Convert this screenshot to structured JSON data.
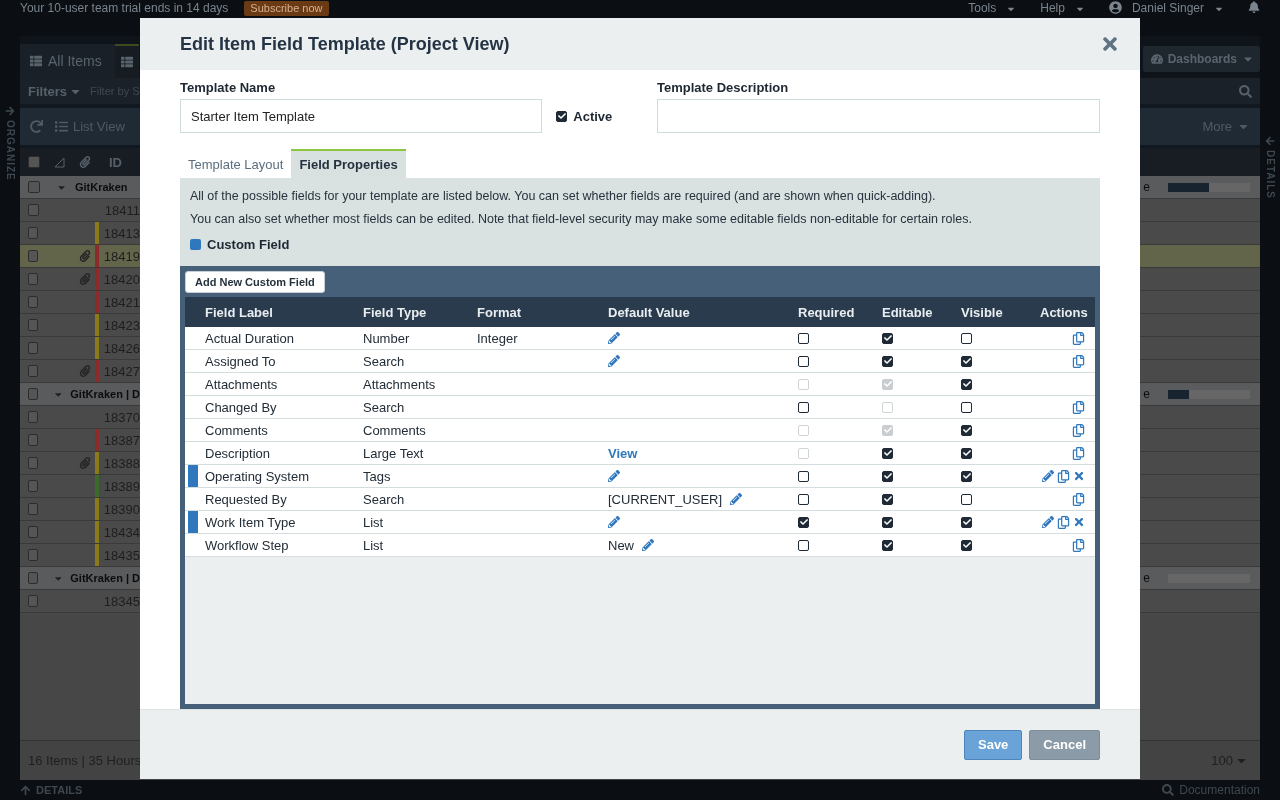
{
  "app": {
    "banner": {
      "text": "Your 10-user team trial ends in 14 days",
      "button": "Subscribe now"
    },
    "top_menu": [
      "Tools",
      "Help"
    ],
    "user": "Daniel Singer",
    "header_checked": false,
    "view_tab": "All Items",
    "dashboards": "Dashboards",
    "filters": "Filters",
    "filter_placeholder": "Filter by S",
    "list_view": "List View",
    "more": "More",
    "id_header": "ID",
    "organize": "ORGANIZE",
    "details_side": "DETAILS",
    "groups": [
      {
        "name": "GitKraken",
        "suffix": "e",
        "level": 0.5,
        "checked": false,
        "items": [
          {
            "id": "18411",
            "attachment": false,
            "selected": false,
            "checked": false
          },
          {
            "id": "18413",
            "attachment": false,
            "selected": false,
            "checked": false,
            "color": "#8a7a1c"
          },
          {
            "id": "18419",
            "attachment": true,
            "selected": true,
            "checked": false,
            "color": "#8a2c2c"
          },
          {
            "id": "18420",
            "attachment": true,
            "selected": false,
            "checked": false,
            "color": "#8a2c2c"
          },
          {
            "id": "18421",
            "attachment": false,
            "selected": false,
            "checked": false,
            "color": "#8a2c2c"
          },
          {
            "id": "18423",
            "attachment": false,
            "selected": false,
            "checked": false,
            "color": "#8a7a1c"
          },
          {
            "id": "18426",
            "attachment": false,
            "selected": false,
            "checked": false,
            "color": "#8a7a1c"
          },
          {
            "id": "18427",
            "attachment": true,
            "selected": false,
            "checked": false,
            "color": "#8a2c2c"
          }
        ]
      },
      {
        "name": "GitKraken | D",
        "suffix": "e",
        "level": 0.25,
        "checked": false,
        "items": [
          {
            "id": "18370",
            "attachment": false,
            "selected": false,
            "checked": false
          },
          {
            "id": "18387",
            "attachment": false,
            "selected": false,
            "checked": false,
            "color": "#8a2c2c"
          },
          {
            "id": "18388",
            "attachment": true,
            "selected": false,
            "checked": false,
            "color": "#8a7a1c"
          },
          {
            "id": "18389",
            "attachment": false,
            "selected": false,
            "checked": false,
            "color": "#3c6a2a"
          },
          {
            "id": "18390",
            "attachment": false,
            "selected": false,
            "checked": false,
            "color": "#8a7a1c"
          },
          {
            "id": "18434",
            "attachment": false,
            "selected": false,
            "checked": false,
            "color": "#8a7a1c"
          },
          {
            "id": "18435",
            "attachment": false,
            "selected": false,
            "checked": false,
            "color": "#8a7a1c"
          }
        ]
      },
      {
        "name": "GitKraken | D",
        "suffix": "e",
        "level": 0,
        "checked": false,
        "items": [
          {
            "id": "18345",
            "attachment": false,
            "selected": false,
            "checked": false
          }
        ]
      }
    ],
    "footer": {
      "summary": "16 Items | 35 Hours",
      "page_size": "100"
    },
    "bottom_bar": {
      "details": "DETAILS",
      "documentation": "Documentation"
    }
  },
  "dialog": {
    "title": "Edit Item Field Template (Project View)",
    "template_name": {
      "label": "Template Name",
      "value": "Starter Item Template"
    },
    "active": {
      "label": "Active",
      "checked": true
    },
    "template_description": {
      "label": "Template Description"
    },
    "tabs": [
      {
        "label": "Template Layout",
        "selected": false
      },
      {
        "label": "Field Properties",
        "selected": true
      }
    ],
    "info": [
      "All of the possible fields for your template are listed below. You can set whether fields are required (and are shown when quick-adding).",
      "You can also set whether most fields can be edited. Note that field-level security may make some editable fields non-editable for certain roles."
    ],
    "legend": {
      "label": "Custom Field",
      "color": "#2f78bd"
    },
    "add_button": "Add New Custom Field",
    "columns": [
      "Field Label",
      "Field Type",
      "Format",
      "Default Value",
      "Required",
      "Editable",
      "Visible",
      "Actions"
    ],
    "rows": [
      {
        "label": "Actual Duration",
        "type": "Number",
        "format": "Integer",
        "custom": false,
        "default": {
          "kind": "edit"
        },
        "required": {
          "checked": false,
          "disabled": false
        },
        "editable": {
          "checked": true,
          "disabled": false
        },
        "visible": {
          "checked": false,
          "disabled": false
        },
        "actions": [
          {
            "kind": "copy"
          }
        ]
      },
      {
        "label": "Assigned To",
        "type": "Search",
        "custom": false,
        "default": {
          "kind": "edit"
        },
        "required": {
          "checked": false,
          "disabled": false
        },
        "editable": {
          "checked": true,
          "disabled": false
        },
        "visible": {
          "checked": true,
          "disabled": false
        },
        "actions": [
          {
            "kind": "copy"
          }
        ]
      },
      {
        "label": "Attachments",
        "type": "Attachments",
        "custom": false,
        "required": {
          "checked": false,
          "disabled": true
        },
        "editable": {
          "checked": true,
          "disabled": true
        },
        "visible": {
          "checked": true,
          "disabled": false
        }
      },
      {
        "label": "Changed By",
        "type": "Search",
        "custom": false,
        "required": {
          "checked": false,
          "disabled": false
        },
        "editable": {
          "checked": false,
          "disabled": true
        },
        "visible": {
          "checked": false,
          "disabled": false
        },
        "actions": [
          {
            "kind": "copy"
          }
        ]
      },
      {
        "label": "Comments",
        "type": "Comments",
        "custom": false,
        "required": {
          "checked": false,
          "disabled": true
        },
        "editable": {
          "checked": true,
          "disabled": true
        },
        "visible": {
          "checked": true,
          "disabled": false
        },
        "actions": [
          {
            "kind": "copy"
          }
        ]
      },
      {
        "label": "Description",
        "type": "Large Text",
        "custom": false,
        "default": {
          "kind": "link",
          "text": "View"
        },
        "required": {
          "checked": false,
          "disabled": true
        },
        "editable": {
          "checked": true,
          "disabled": false
        },
        "visible": {
          "checked": true,
          "disabled": false
        },
        "actions": [
          {
            "kind": "copy"
          }
        ]
      },
      {
        "label": "Operating System",
        "type": "Tags",
        "custom": true,
        "default": {
          "kind": "edit"
        },
        "required": {
          "checked": false,
          "disabled": false
        },
        "editable": {
          "checked": true,
          "disabled": false
        },
        "visible": {
          "checked": true,
          "disabled": false
        },
        "actions": [
          {
            "kind": "edit"
          },
          {
            "kind": "copy"
          },
          {
            "kind": "delete"
          }
        ]
      },
      {
        "label": "Requested By",
        "type": "Search",
        "custom": false,
        "default": {
          "kind": "value",
          "text": "[CURRENT_USER]"
        },
        "required": {
          "checked": false,
          "disabled": false
        },
        "editable": {
          "checked": true,
          "disabled": false
        },
        "visible": {
          "checked": false,
          "disabled": false
        },
        "actions": [
          {
            "kind": "copy"
          }
        ]
      },
      {
        "label": "Work Item Type",
        "type": "List",
        "custom": true,
        "default": {
          "kind": "edit"
        },
        "required": {
          "checked": true,
          "disabled": false
        },
        "editable": {
          "checked": true,
          "disabled": false
        },
        "visible": {
          "checked": true,
          "disabled": false
        },
        "actions": [
          {
            "kind": "edit"
          },
          {
            "kind": "copy"
          },
          {
            "kind": "delete"
          }
        ]
      },
      {
        "label": "Workflow Step",
        "type": "List",
        "custom": false,
        "default": {
          "kind": "value",
          "text": "New"
        },
        "required": {
          "checked": false,
          "disabled": false
        },
        "editable": {
          "checked": true,
          "disabled": false
        },
        "visible": {
          "checked": true,
          "disabled": false
        },
        "actions": [
          {
            "kind": "copy"
          }
        ]
      }
    ],
    "buttons": [
      {
        "label": "Save",
        "kind": "primary"
      },
      {
        "label": "Cancel",
        "kind": "secondary"
      }
    ]
  }
}
